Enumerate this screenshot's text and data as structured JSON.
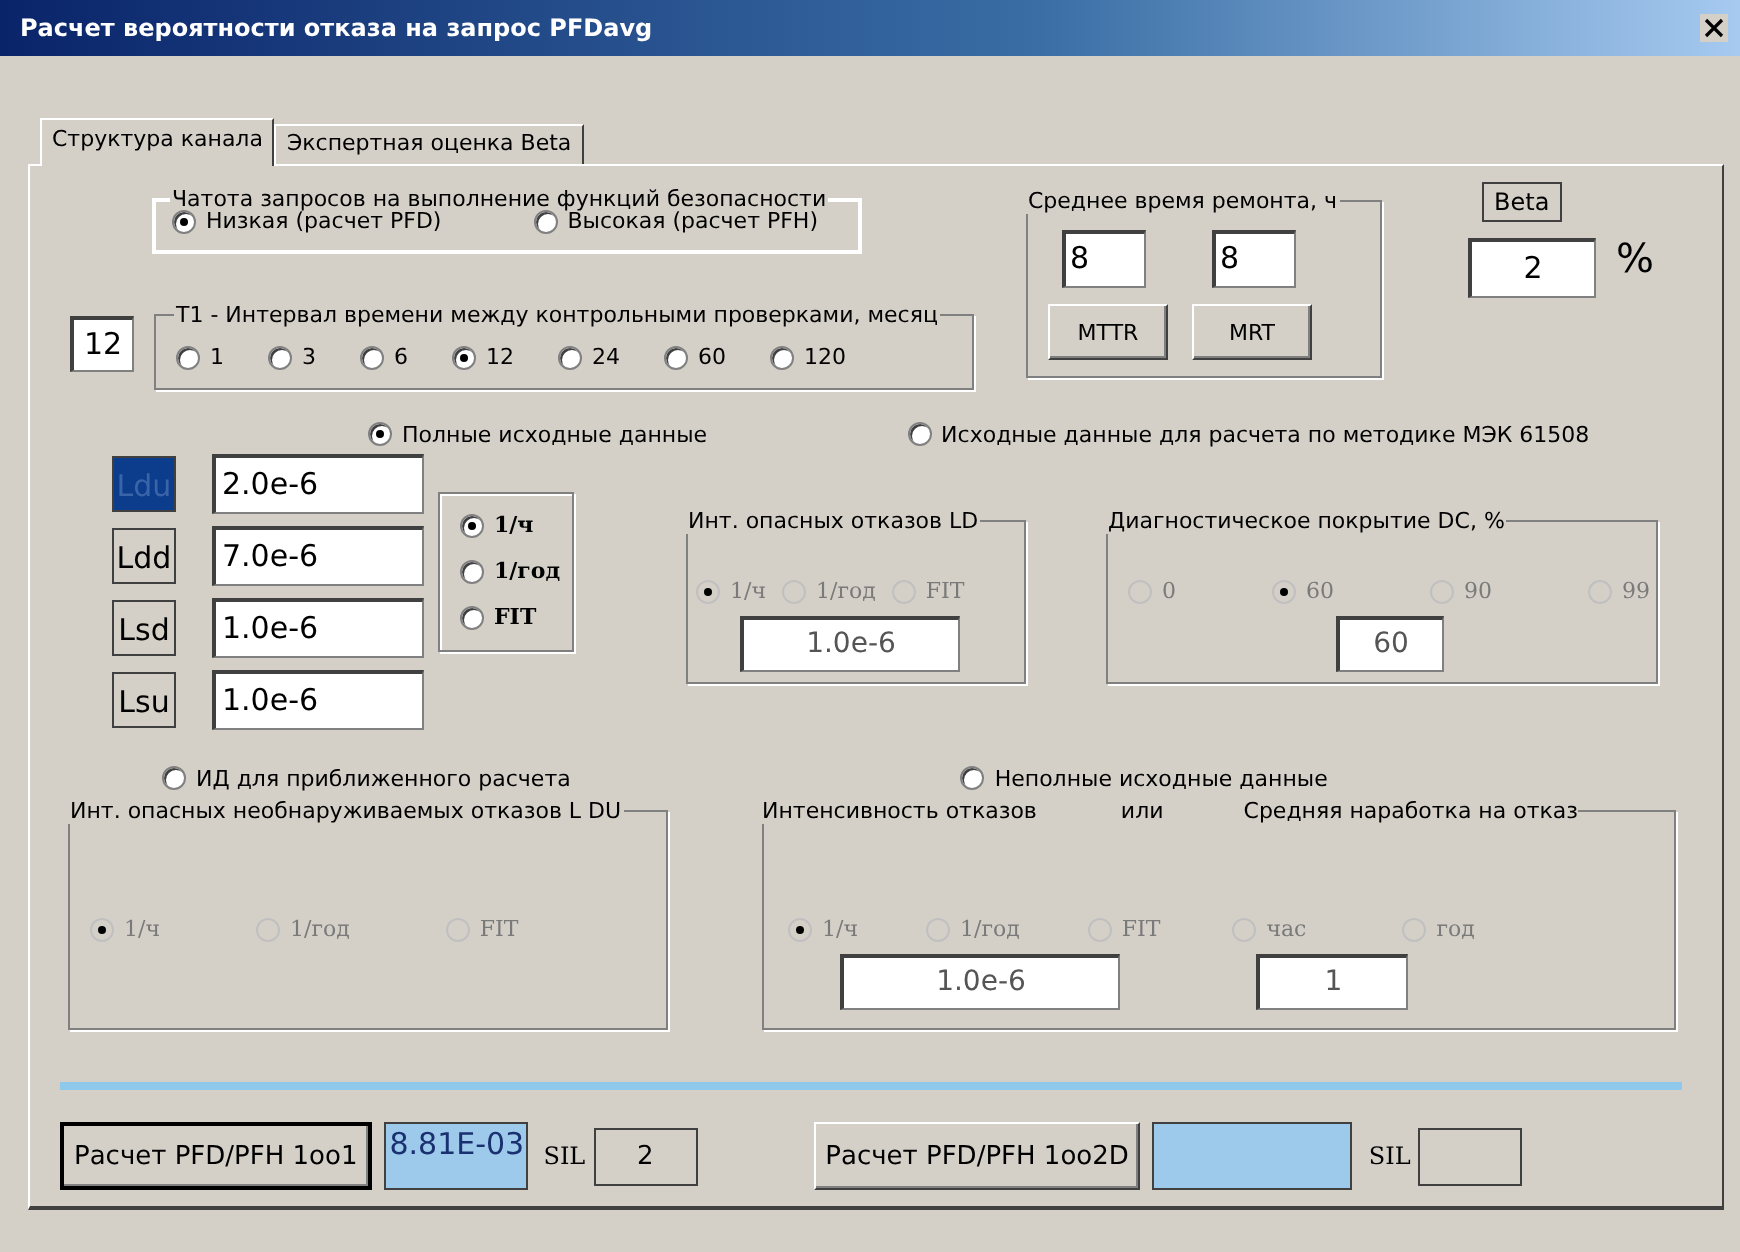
{
  "window": {
    "title": "Расчет вероятности отказа на запрос PFDavg"
  },
  "tabs": [
    {
      "label": "Структура канала",
      "selected": true
    },
    {
      "label": "Экспертная оценка Beta",
      "selected": false
    }
  ],
  "demand_mode": {
    "title": "Чатота запросов на выполнение функций безопасности",
    "options": [
      {
        "label": "Низкая (расчет PFD)",
        "selected": true
      },
      {
        "label": "Высокая (расчет PFH)",
        "selected": false
      }
    ]
  },
  "t1": {
    "value": "12",
    "title": "T1 - Интервал времени между контрольными проверками, месяц",
    "options": [
      {
        "label": "1",
        "selected": false
      },
      {
        "label": "3",
        "selected": false
      },
      {
        "label": "6",
        "selected": false
      },
      {
        "label": "12",
        "selected": true
      },
      {
        "label": "24",
        "selected": false
      },
      {
        "label": "60",
        "selected": false
      },
      {
        "label": "120",
        "selected": false
      }
    ]
  },
  "repair": {
    "title": "Среднее время ремонта, ч",
    "items": [
      {
        "value": "8",
        "button": "MTTR"
      },
      {
        "value": "8",
        "button": "MRT"
      }
    ]
  },
  "beta": {
    "label": "Beta",
    "value": "2",
    "unit": "%"
  },
  "data_modes": [
    {
      "label": "Полные исходные данные",
      "selected": true
    },
    {
      "label": "Исходные данные для расчета по методике МЭК 61508",
      "selected": false
    }
  ],
  "rates": [
    {
      "label": "Ldu",
      "value": "2.0e-6",
      "selected": true
    },
    {
      "label": "Ldd",
      "value": "7.0e-6",
      "selected": false
    },
    {
      "label": "Lsd",
      "value": "1.0e-6",
      "selected": false
    },
    {
      "label": "Lsu",
      "value": "1.0e-6",
      "selected": false
    }
  ],
  "rate_units": [
    {
      "label": "1/ч",
      "selected": true
    },
    {
      "label": "1/год",
      "selected": false
    },
    {
      "label": "FIT",
      "selected": false
    }
  ],
  "ld_group": {
    "title": "Инт. опасных отказов LD",
    "disabled": true,
    "options": [
      {
        "label": "1/ч",
        "selected": true
      },
      {
        "label": "1/год",
        "selected": false
      },
      {
        "label": "FIT",
        "selected": false
      }
    ],
    "value": "1.0e-6"
  },
  "dc_group": {
    "title": "Диагностическое покрытие DC, %",
    "disabled": true,
    "options": [
      {
        "label": "0",
        "selected": false
      },
      {
        "label": "60",
        "selected": true
      },
      {
        "label": "90",
        "selected": false
      },
      {
        "label": "99",
        "selected": false
      }
    ],
    "value": "60"
  },
  "approx_modes": [
    {
      "label": "ИД для приближенного расчета",
      "selected": false
    },
    {
      "label": "Неполные исходные данные",
      "selected": false
    }
  ],
  "ldu_group": {
    "title": "Инт. опасных необнаруживаемых отказов L DU",
    "disabled": true,
    "options": [
      {
        "label": "1/ч",
        "selected": true
      },
      {
        "label": "1/год",
        "selected": false
      },
      {
        "label": "FIT",
        "selected": false
      }
    ]
  },
  "failure_group": {
    "title": "Интенсивность отказов",
    "separator": "или",
    "title2": "Средняя наработка на отказ",
    "disabled": true,
    "rate_options": [
      {
        "label": "1/ч",
        "selected": true
      },
      {
        "label": "1/год",
        "selected": false
      },
      {
        "label": "FIT",
        "selected": false
      }
    ],
    "rate_value": "1.0e-6",
    "mtbf_options": [
      {
        "label": "час",
        "selected": false
      },
      {
        "label": "год",
        "selected": false
      }
    ],
    "mtbf_value": "1"
  },
  "results": [
    {
      "button": "Расчет PFD/PFH 1oo1",
      "default": true,
      "value": "8.81E-03",
      "sil_label": "SIL",
      "sil": "2"
    },
    {
      "button": "Расчет PFD/PFH 1oo2D",
      "default": false,
      "sil_label": "SIL"
    }
  ]
}
